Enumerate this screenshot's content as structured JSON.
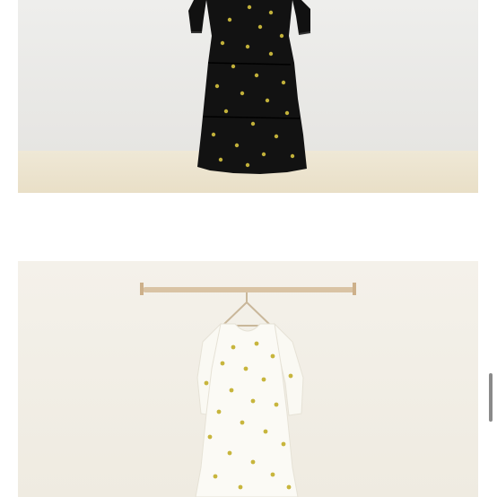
{
  "gallery": {
    "items": [
      {
        "subject": "black-polka-dot-dress",
        "dress_color": "#111111",
        "dot_color": "#c2b13a",
        "wall_color": "#ececea",
        "floor_color": "#eee6d2"
      },
      {
        "subject": "white-polka-dot-dress",
        "dress_color": "#fbfaf5",
        "dot_color": "#c7b53c",
        "wall_color": "#f3f0e8",
        "rail_color": "#d9c3a4"
      }
    ]
  },
  "scrollbar": {
    "color": "#8a8a8a"
  }
}
